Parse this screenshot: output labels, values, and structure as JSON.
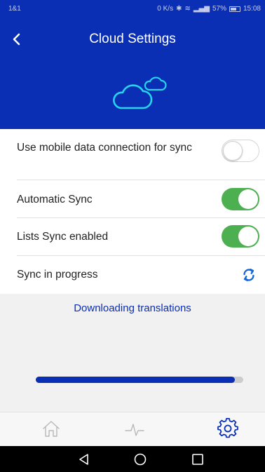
{
  "status_bar": {
    "carrier": "1&1",
    "speed": "0 K/s",
    "battery": "57%",
    "time": "15:08"
  },
  "header": {
    "title": "Cloud Settings",
    "back_icon": "chevron-left-icon",
    "logo_icon": "cloud-icon"
  },
  "settings": {
    "mobile_data": {
      "label": "Use mobile data connection for sync",
      "enabled": false
    },
    "automatic_sync": {
      "label": "Automatic Sync",
      "enabled": true
    },
    "lists_sync": {
      "label": "Lists Sync enabled",
      "enabled": true
    },
    "sync_progress": {
      "label": "Sync in progress",
      "icon": "sync-icon"
    }
  },
  "progress": {
    "text": "Downloading translations",
    "value": 0.96
  },
  "tab_bar": {
    "items": [
      "home-icon",
      "activity-icon",
      "settings-gear-icon"
    ],
    "active": "settings-gear-icon"
  },
  "android_nav": [
    "back-triangle-icon",
    "home-circle-icon",
    "recents-square-icon"
  ],
  "colors": {
    "primary": "#0a2fb4",
    "toggle_on": "#4caf50",
    "progress_bg": "#f1f1f1",
    "inactive_icon": "#b8b8b8"
  }
}
